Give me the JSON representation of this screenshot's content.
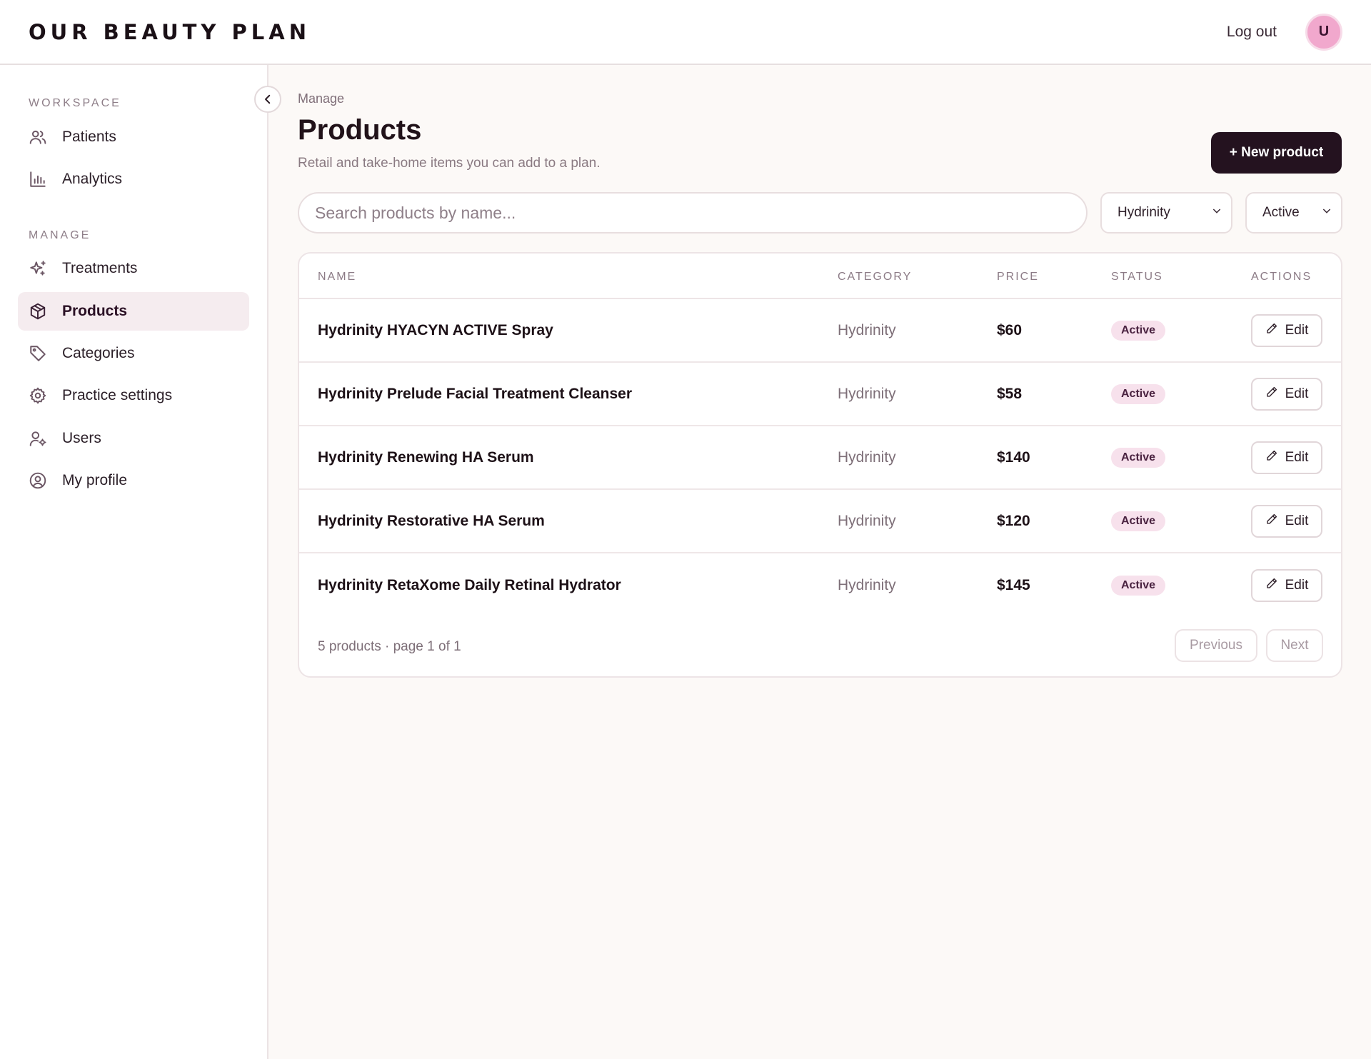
{
  "header": {
    "brand": "OUR BEAUTY PLAN",
    "logout_label": "Log out",
    "avatar_initial": "U"
  },
  "sidebar": {
    "workspace_label": "WORKSPACE",
    "manage_label": "MANAGE",
    "workspace_items": [
      {
        "label": "Patients",
        "icon": "users-icon"
      },
      {
        "label": "Analytics",
        "icon": "bar-chart-icon"
      }
    ],
    "manage_items": [
      {
        "label": "Treatments",
        "icon": "sparkles-icon"
      },
      {
        "label": "Products",
        "icon": "box-icon",
        "active": true
      },
      {
        "label": "Categories",
        "icon": "tag-icon"
      },
      {
        "label": "Practice settings",
        "icon": "gear-icon"
      },
      {
        "label": "Users",
        "icon": "user-cog-icon"
      },
      {
        "label": "My profile",
        "icon": "user-circle-icon"
      }
    ]
  },
  "main": {
    "breadcrumb": "Manage",
    "title": "Products",
    "subtitle": "Retail and take-home items you can add to a plan.",
    "new_button_label": "+ New product",
    "search_placeholder": "Search products by name...",
    "category_filter": "Hydrinity",
    "status_filter": "Active"
  },
  "table": {
    "columns": [
      "NAME",
      "CATEGORY",
      "PRICE",
      "STATUS",
      "ACTIONS"
    ],
    "rows": [
      {
        "name": "Hydrinity HYACYN ACTIVE Spray",
        "category": "Hydrinity",
        "price": "$60",
        "status": "Active",
        "action": "Edit"
      },
      {
        "name": "Hydrinity Prelude Facial Treatment Cleanser",
        "category": "Hydrinity",
        "price": "$58",
        "status": "Active",
        "action": "Edit"
      },
      {
        "name": "Hydrinity Renewing HA Serum",
        "category": "Hydrinity",
        "price": "$140",
        "status": "Active",
        "action": "Edit"
      },
      {
        "name": "Hydrinity Restorative HA Serum",
        "category": "Hydrinity",
        "price": "$120",
        "status": "Active",
        "action": "Edit"
      },
      {
        "name": "Hydrinity RetaXome Daily Retinal Hydrator",
        "category": "Hydrinity",
        "price": "$145",
        "status": "Active",
        "action": "Edit"
      }
    ],
    "footer_text": "5 products · page 1 of 1",
    "previous_label": "Previous",
    "next_label": "Next"
  },
  "colors": {
    "accent_dark": "#24121f",
    "avatar_pink": "#f1a8cd",
    "active_nav_bg": "#f5ecef",
    "badge_bg": "#f7e1ec",
    "page_bg": "#fcf9f7"
  }
}
